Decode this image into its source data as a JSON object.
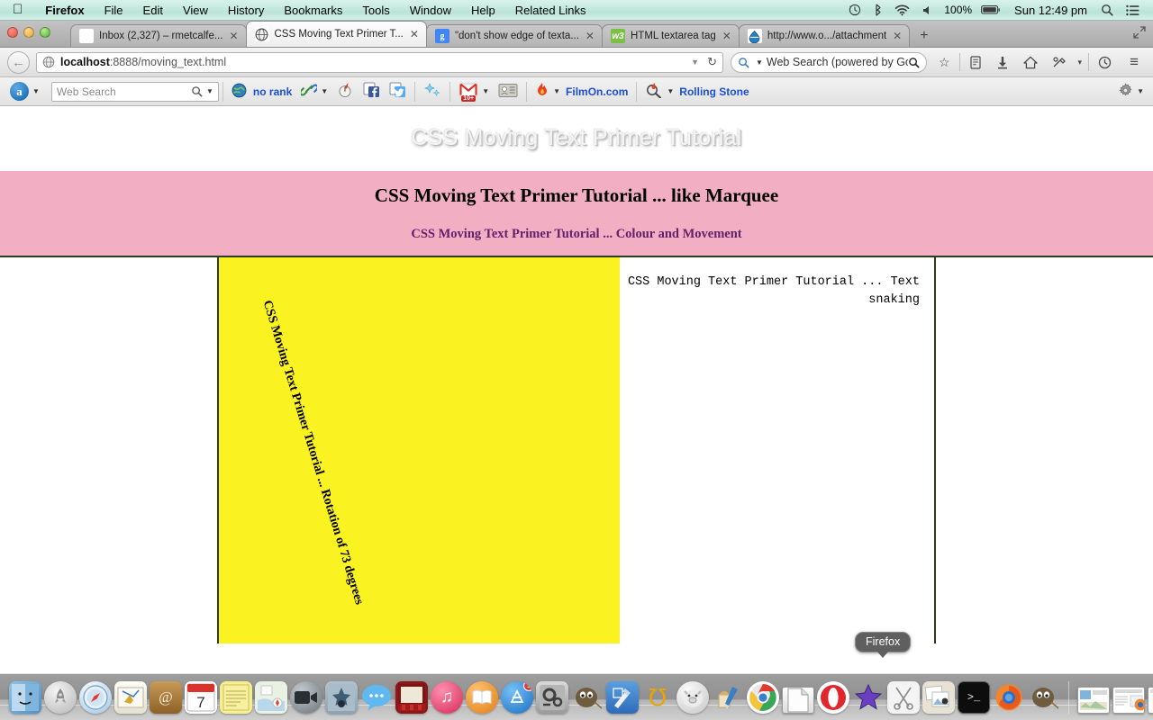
{
  "menubar": {
    "apple_icon": "apple-icon",
    "items": [
      {
        "label": "Firefox",
        "bold": true
      },
      {
        "label": "File",
        "bold": false
      },
      {
        "label": "Edit",
        "bold": false
      },
      {
        "label": "View",
        "bold": false
      },
      {
        "label": "History",
        "bold": false
      },
      {
        "label": "Bookmarks",
        "bold": false
      },
      {
        "label": "Tools",
        "bold": false
      },
      {
        "label": "Window",
        "bold": false
      },
      {
        "label": "Help",
        "bold": false
      },
      {
        "label": "Related Links",
        "bold": false
      }
    ],
    "status": {
      "timemachine_icon": "time-machine-icon",
      "bluetooth_icon": "bluetooth-icon",
      "wifi_icon": "wifi-icon",
      "volume_icon": "volume-icon",
      "battery_percent": "100%",
      "battery_icon": "battery-icon",
      "clock": "Sun 12:49 pm",
      "spotlight_icon": "search-icon",
      "notifications_icon": "notification-center-icon"
    }
  },
  "browser": {
    "tabs": [
      {
        "title": "Inbox (2,327) – rmetcalfe...",
        "favicon": "gmail-icon",
        "active": false
      },
      {
        "title": "CSS Moving Text Primer T...",
        "favicon": "globe-icon",
        "active": true
      },
      {
        "title": "\"don't show edge of texta...",
        "favicon": "google-icon",
        "active": false
      },
      {
        "title": "HTML textarea tag",
        "favicon": "w3schools-icon",
        "active": false
      },
      {
        "title": "http://www.o.../attachment",
        "favicon": "blue-drop-icon",
        "active": false
      }
    ],
    "new_tab_label": "+",
    "close_label": "✕",
    "navbar": {
      "back_icon": "back-arrow-icon",
      "url_host": "localhost",
      "url_rest": ":8888/moving_text.html",
      "url_full": "localhost:8888/moving_text.html",
      "identity_icon": "globe-icon",
      "dropdown_icon": "chevron-down-icon",
      "reload_icon": "reload-icon",
      "search_placeholder": "Web Search (powered by Goo",
      "search_icon": "search-icon",
      "icons": [
        {
          "name": "bookmark-star-icon",
          "glyph": "☆"
        },
        {
          "name": "reading-list-icon",
          "glyph": "☰"
        },
        {
          "name": "downloads-icon",
          "glyph": "⬇"
        },
        {
          "name": "home-icon",
          "glyph": "⌂"
        },
        {
          "name": "addon-icon",
          "glyph": "✵"
        },
        {
          "name": "chevron-down-icon",
          "glyph": "▾"
        },
        {
          "name": "history-icon",
          "glyph": "↺"
        },
        {
          "name": "hamburger-menu-icon",
          "glyph": "≡"
        }
      ]
    },
    "bookmarks_bar": {
      "alexa_label": "a",
      "web_search_placeholder": "Web Search",
      "no_rank_label": "no rank",
      "filmon_label": "FilmOn.com",
      "rolling_stone_label": "Rolling Stone",
      "gmail_badge": "10+",
      "icons": [
        {
          "name": "alexa-icon"
        },
        {
          "name": "alexa-globe-icon"
        },
        {
          "name": "link-chain-icon"
        },
        {
          "name": "stumbleupon-icon"
        },
        {
          "name": "facebook-share-icon"
        },
        {
          "name": "twitter-share-icon"
        },
        {
          "name": "sparkle-icon"
        },
        {
          "name": "gmail-notifier-icon"
        },
        {
          "name": "contacts-icon"
        },
        {
          "name": "filmon-flame-icon"
        },
        {
          "name": "rolling-stone-icon"
        },
        {
          "name": "settings-gear-icon"
        }
      ]
    }
  },
  "page": {
    "watermark_title": "CSS Moving Text Primer Tutorial",
    "banner": {
      "heading": "CSS Moving Text Primer Tutorial ... like Marquee",
      "subheading": "CSS Moving Text Primer Tutorial ... Colour and Movement",
      "background_color": "#f2aec3",
      "heading_color": "#000000",
      "subheading_color": "#63206b"
    },
    "yellow_panel": {
      "background_color": "#fbf221",
      "rotated_text": "CSS Moving Text Primer Tutorial ... Rotation of 73 degrees",
      "rotation_degrees": 73
    },
    "snaking_panel": {
      "text": "CSS Moving Text Primer Tutorial ... Text snaking"
    }
  },
  "tooltip": {
    "label": "Firefox"
  },
  "dock": {
    "apps": [
      {
        "name": "finder-icon",
        "glyph": "🙂",
        "bg": "#6fa8dc"
      },
      {
        "name": "launchpad-icon",
        "glyph": "🚀",
        "bg": "#c8c8c8"
      },
      {
        "name": "safari-icon",
        "glyph": "🧭",
        "bg": "#dfe8f0"
      },
      {
        "name": "mail-icon",
        "glyph": "✉",
        "bg": "#f2f0e6"
      },
      {
        "name": "contacts-icon",
        "glyph": "@",
        "bg": "#b07b3e"
      },
      {
        "name": "calendar-icon",
        "glyph": "7",
        "bg": "#ffffff"
      },
      {
        "name": "notes-icon",
        "glyph": "≡",
        "bg": "#f6ee8a"
      },
      {
        "name": "maps-icon",
        "glyph": "▲",
        "bg": "#e7efe0"
      },
      {
        "name": "facetime-icon",
        "glyph": "●",
        "bg": "#9aa0a6"
      },
      {
        "name": "photobooth-icon",
        "glyph": "✹",
        "bg": "#9fb1bd"
      },
      {
        "name": "messages-icon",
        "glyph": "💬",
        "bg": "#6ec1f0"
      },
      {
        "name": "imovie-theater-icon",
        "glyph": "■",
        "bg": "#a32020"
      },
      {
        "name": "itunes-icon",
        "glyph": "♫",
        "bg": "#e8436d"
      },
      {
        "name": "ibooks-icon",
        "glyph": "📖",
        "bg": "#f0952a"
      },
      {
        "name": "app-store-icon",
        "glyph": "A",
        "bg": "#2f8fe0"
      },
      {
        "name": "system-preferences-icon",
        "glyph": "⚙",
        "bg": "#8e8e8e"
      },
      {
        "name": "gimp-icon",
        "glyph": "🐺",
        "bg": "#8b7355"
      },
      {
        "name": "xcode-icon",
        "glyph": "⚒",
        "bg": "#3f7fd0"
      },
      {
        "name": "wolfram-icon",
        "glyph": "W",
        "bg": "#f0a500"
      },
      {
        "name": "pig-icon",
        "glyph": "●",
        "bg": "#d8d8d8"
      },
      {
        "name": "paintbrush-icon",
        "glyph": "✎",
        "bg": "#e6c88a"
      },
      {
        "name": "chrome-icon",
        "glyph": "◉",
        "bg": "#ffffff"
      },
      {
        "name": "libreoffice-icon",
        "glyph": "□",
        "bg": "#ffffff"
      },
      {
        "name": "opera-icon",
        "glyph": "O",
        "bg": "#e1262c"
      },
      {
        "name": "imovie-icon",
        "glyph": "★",
        "bg": "#5b3ea8"
      },
      {
        "name": "screenshot-icon",
        "glyph": "✂",
        "bg": "#f0f0f0"
      },
      {
        "name": "iphoto-icon",
        "glyph": "▣",
        "bg": "#e8e0d0"
      },
      {
        "name": "terminal-icon",
        "glyph": ">_",
        "bg": "#111111"
      },
      {
        "name": "firefox-icon",
        "glyph": "🦊",
        "bg": "#f08020"
      },
      {
        "name": "gimp2-icon",
        "glyph": "🐺",
        "bg": "#8b7355"
      }
    ],
    "windows": [
      {
        "name": "minimized-window-gallery"
      },
      {
        "name": "minimized-window-firefox-1"
      },
      {
        "name": "minimized-window-firefox-2"
      },
      {
        "name": "minimized-window-document"
      },
      {
        "name": "minimized-window-paint"
      }
    ],
    "trash": {
      "name": "trash-icon"
    }
  }
}
